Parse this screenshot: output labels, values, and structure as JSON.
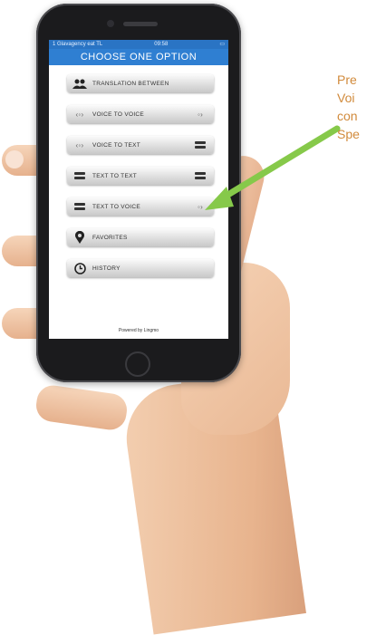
{
  "status_bar": {
    "carrier": "1 Glavagency eat TL",
    "time": "09:58"
  },
  "screen_title": "CHOOSE ONE OPTION",
  "options": [
    {
      "label": "TRANSLATION BETWEEN",
      "left_icon": "people-icon",
      "right_icon": ""
    },
    {
      "label": "VOICE TO VOICE",
      "left_icon": "sound-wave-icon",
      "right_icon": "sound-wave-icon"
    },
    {
      "label": "VOICE TO TEXT",
      "left_icon": "sound-wave-icon",
      "right_icon": "text-bars-icon"
    },
    {
      "label": "TEXT TO TEXT",
      "left_icon": "text-bars-icon",
      "right_icon": "text-bars-icon"
    },
    {
      "label": "TEXT TO VOICE",
      "left_icon": "text-bars-icon",
      "right_icon": "sound-wave-icon"
    },
    {
      "label": "FAVORITES",
      "left_icon": "map-pin-icon",
      "right_icon": ""
    },
    {
      "label": "HISTORY",
      "left_icon": "clock-icon",
      "right_icon": ""
    }
  ],
  "footer": "Powered by Lingmo",
  "callout": {
    "lines": [
      "Pre",
      "Voi",
      "con",
      "Spe"
    ],
    "color": "#d18a3b"
  },
  "colors": {
    "accent": "#2f7fd2",
    "arrow": "#86c94a"
  }
}
